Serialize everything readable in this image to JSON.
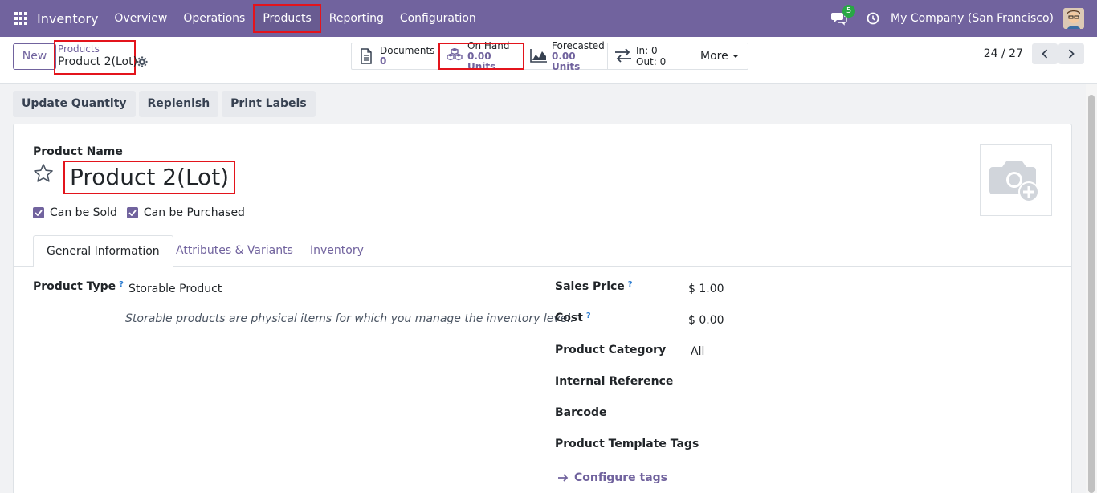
{
  "navbar": {
    "app_name": "Inventory",
    "menu": [
      "Overview",
      "Operations",
      "Products",
      "Reporting",
      "Configuration"
    ],
    "chat_count": "5",
    "company": "My Company (San Francisco)"
  },
  "control": {
    "new_label": "New",
    "breadcrumb_parent": "Products",
    "breadcrumb_current": "Product 2(Lot)",
    "smart_buttons": {
      "documents_label": "Documents",
      "documents_value": "0",
      "onhand_label": "On Hand",
      "onhand_value": "0.00 Units",
      "forecasted_label": "Forecasted",
      "forecasted_value": "0.00 Units",
      "in_label": "In:",
      "in_value": "0",
      "out_label": "Out:",
      "out_value": "0",
      "more_label": "More"
    },
    "pager": "24 / 27"
  },
  "actions": {
    "update_quantity": "Update Quantity",
    "replenish": "Replenish",
    "print_labels": "Print Labels"
  },
  "form": {
    "product_name_label": "Product Name",
    "product_name": "Product 2(Lot)",
    "can_be_sold": "Can be Sold",
    "can_be_purchased": "Can be Purchased",
    "tabs": [
      "General Information",
      "Attributes & Variants",
      "Inventory"
    ],
    "product_type_label": "Product Type",
    "product_type_value": "Storable Product",
    "product_type_hint": "Storable products are physical items for which you manage the inventory level.",
    "sales_price_label": "Sales Price",
    "sales_price_value": "$ 1.00",
    "cost_label": "Cost",
    "cost_value": "$ 0.00",
    "product_category_label": "Product Category",
    "product_category_value": "All",
    "internal_reference_label": "Internal Reference",
    "barcode_label": "Barcode",
    "product_template_tags_label": "Product Template Tags",
    "configure_tags": "Configure tags",
    "help_mark": "?"
  },
  "colors": {
    "brand": "#71639e",
    "highlight": "#e3141c",
    "badge": "#28a745"
  }
}
